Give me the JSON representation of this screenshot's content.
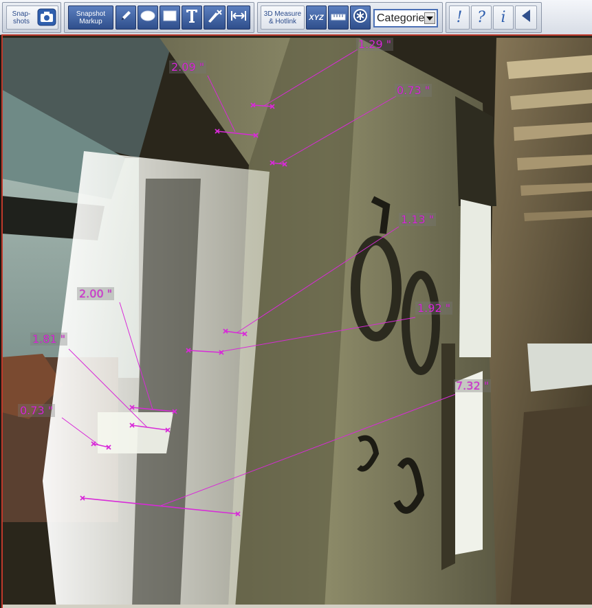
{
  "toolbar": {
    "snapshots_label": "Snap-\nshots",
    "snapshot_markup_label": "Snapshot\nMarkup",
    "measure_hotlink_label": "3D Measure\n& Hotlink",
    "xyz_label": "XYZ",
    "category_value": "Categorie",
    "colors": {
      "accent": "#2f4f8c",
      "measure": "#d82ad8"
    }
  },
  "measurements": [
    {
      "label": "1.29 \""
    },
    {
      "label": "2.09 \""
    },
    {
      "label": "0.73 \""
    },
    {
      "label": "1.13 \""
    },
    {
      "label": "1.92 \""
    },
    {
      "label": "2.00 \""
    },
    {
      "label": "1.81 \""
    },
    {
      "label": "0.73 \""
    },
    {
      "label": "7.32 \""
    }
  ]
}
